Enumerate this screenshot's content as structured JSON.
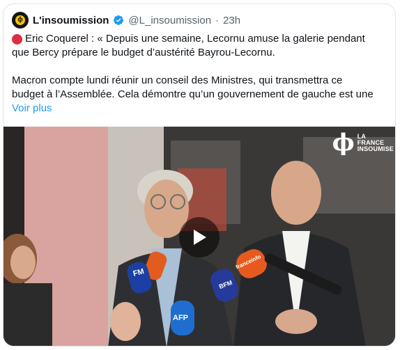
{
  "tweet": {
    "author_name": "L'insoumission",
    "handle": "@L_insoumission",
    "separator": "·",
    "time": "23h",
    "text_lines": [
      "Eric Coquerel : « Depuis une semaine, Lecornu amuse la galerie pendant",
      "que Bercy prépare le budget d’austérité Bayrou-Lecornu.",
      "Macron compte lundi réunir un conseil des Ministres, qui transmettra ce",
      "budget à l’Assemblée. Cela démontre qu’un gouvernement de gauche est une"
    ],
    "see_more": "Voir plus"
  },
  "media": {
    "watermark_line1": "LA",
    "watermark_line2": "FRANCE",
    "watermark_line3": "INSOUMISE",
    "mic_labels": [
      "FM",
      "BFM",
      "AFP",
      "franceinfo"
    ]
  },
  "colors": {
    "accent_link": "#1d9bf0",
    "verified_badge": "#1d9bf0",
    "muted_text": "#536471",
    "red_circle": "#dd2e44"
  },
  "icons": [
    "avatar-logo",
    "verified-badge-icon",
    "red-circle-emoji",
    "play-icon"
  ]
}
